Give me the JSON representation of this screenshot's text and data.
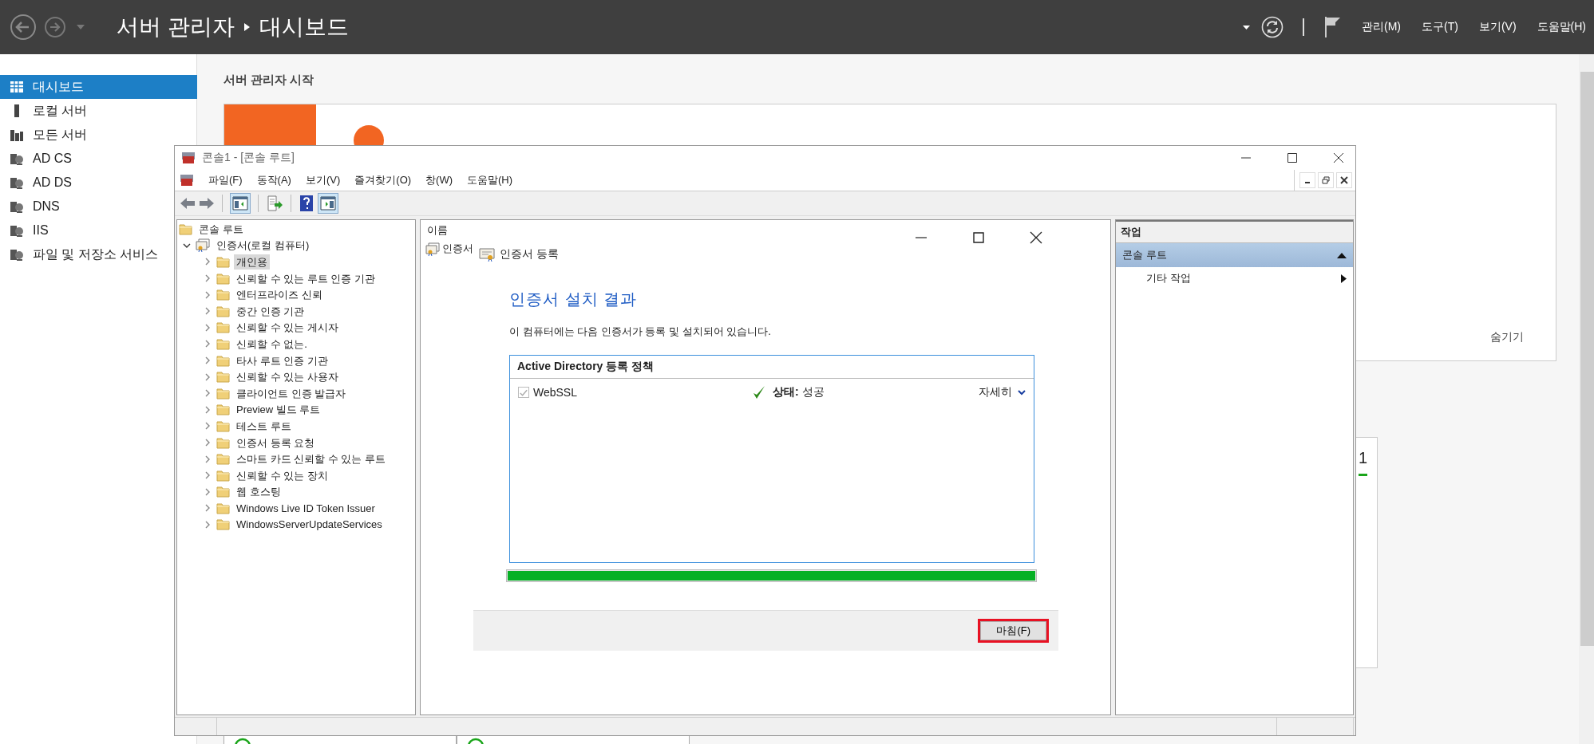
{
  "server_manager": {
    "app_title": "서버 관리자",
    "page_title": "대시보드",
    "menus": [
      "관리(M)",
      "도구(T)",
      "보기(V)",
      "도움말(H)"
    ]
  },
  "sidebar": {
    "items": [
      {
        "label": "대시보드",
        "selected": true
      },
      {
        "label": "로컬 서버",
        "selected": false
      },
      {
        "label": "모든 서버",
        "selected": false
      },
      {
        "label": "AD CS",
        "selected": false
      },
      {
        "label": "AD DS",
        "selected": false
      },
      {
        "label": "DNS",
        "selected": false
      },
      {
        "label": "IIS",
        "selected": false
      },
      {
        "label": "파일 및 저장소 서비스",
        "selected": false
      }
    ]
  },
  "dashboard": {
    "heading": "서버 관리자 시작",
    "quick_start": {
      "hide_link": "숨기기"
    },
    "tile": {
      "count": "1"
    }
  },
  "mmc": {
    "title": "콘솔1 - [콘솔 루트]",
    "menus": [
      "파일(F)",
      "동작(A)",
      "보기(V)",
      "즐겨찾기(O)",
      "창(W)",
      "도움말(H)"
    ],
    "tree": [
      {
        "label": "콘솔 루트",
        "selected": false,
        "children": [
          {
            "label": "인증서(로컬 컴퓨터)",
            "expanded": true,
            "selected": false,
            "children": [
              {
                "label": "개인용",
                "expanded": false,
                "selected": true
              },
              {
                "label": "신뢰할 수 있는 루트 인증 기관",
                "expanded": false,
                "selected": false
              },
              {
                "label": "엔터프라이즈 신뢰",
                "expanded": false,
                "selected": false
              },
              {
                "label": "중간 인증 기관",
                "expanded": false,
                "selected": false
              },
              {
                "label": "신뢰할 수 있는 게시자",
                "expanded": false,
                "selected": false
              },
              {
                "label": "신뢰할 수 없는.",
                "expanded": false,
                "selected": false
              },
              {
                "label": "타사 루트 인증 기관",
                "expanded": false,
                "selected": false
              },
              {
                "label": "신뢰할 수 있는 사용자",
                "expanded": false,
                "selected": false
              },
              {
                "label": "클라이언트 인증 발급자",
                "expanded": false,
                "selected": false
              },
              {
                "label": "Preview 빌드 루트",
                "expanded": false,
                "selected": false
              },
              {
                "label": "테스트 루트",
                "expanded": false,
                "selected": false
              },
              {
                "label": "인증서 등록 요청",
                "expanded": false,
                "selected": false
              },
              {
                "label": "스마트 카드 신뢰할 수 있는 루트",
                "expanded": false,
                "selected": false
              },
              {
                "label": "신뢰할 수 있는 장치",
                "expanded": false,
                "selected": false
              },
              {
                "label": "웹 호스팅",
                "expanded": false,
                "selected": false
              },
              {
                "label": "Windows Live ID Token Issuer",
                "expanded": false,
                "selected": false
              },
              {
                "label": "WindowsServerUpdateServices",
                "expanded": false,
                "selected": false
              }
            ]
          }
        ]
      }
    ],
    "list": {
      "column": "이름",
      "items": [
        "인증서"
      ]
    },
    "actions": {
      "header": "작업",
      "section": "콘솔 루트",
      "expanded": true,
      "items": [
        "기타 작업"
      ]
    }
  },
  "dialog": {
    "wizard_title": "인증서 등록",
    "heading": "인증서 설치 결과",
    "description": "이 컴퓨터에는 다음 인증서가 등록 및 설치되어 있습니다.",
    "group": "Active Directory 등록 정책",
    "rows": [
      {
        "name": "WebSSL",
        "checked": true,
        "disabled": true,
        "status": "**상태:** 성공",
        "details": "자세히"
      }
    ],
    "progress": {
      "level": 1
    },
    "finish_button": "마침(F)"
  }
}
